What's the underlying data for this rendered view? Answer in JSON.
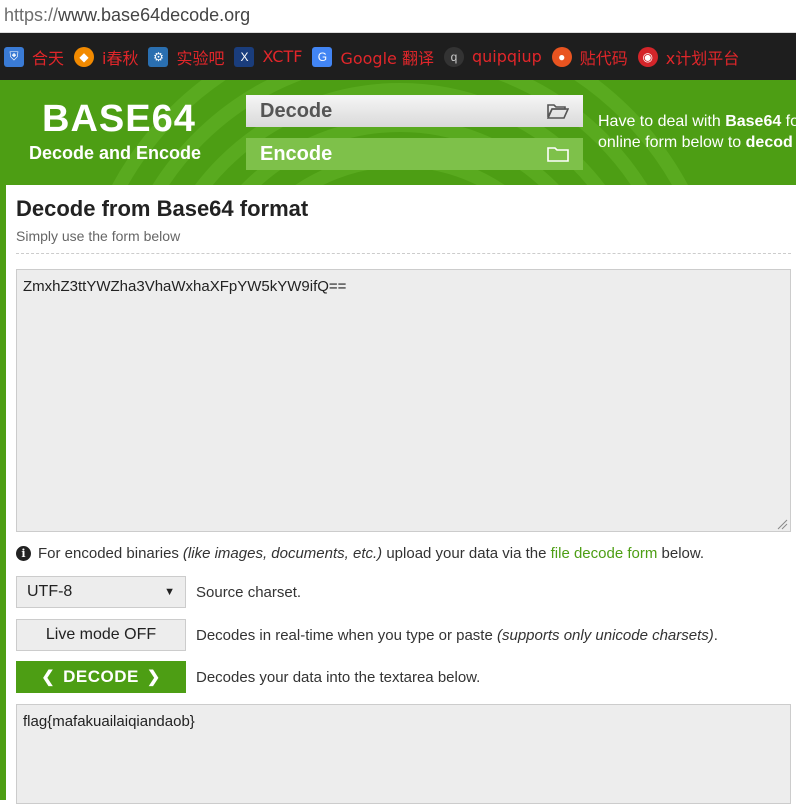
{
  "browser": {
    "url_scheme": "https://",
    "url_host": "www.base64decode.org"
  },
  "bookmarks": [
    {
      "label": "合天",
      "icon": "shield-icon",
      "color": "#3a7bd5"
    },
    {
      "label": "i春秋",
      "icon": "ichunqiu-icon",
      "color": "#f28a00"
    },
    {
      "label": "实验吧",
      "icon": "shiyanbar-icon",
      "color": "#2a6fb0"
    },
    {
      "label": "XCTF",
      "icon": "xctf-icon",
      "color": "#1a3d7c"
    },
    {
      "label": "Google 翻译",
      "icon": "google-translate-icon",
      "color": "#4285f4"
    },
    {
      "label": "quipqiup",
      "icon": "quipqiup-icon",
      "color": "#333333"
    },
    {
      "label": "贴代码",
      "icon": "ubuntu-icon",
      "color": "#e95420"
    },
    {
      "label": "x计划平台",
      "icon": "globe-icon",
      "color": "#d4252a"
    }
  ],
  "header": {
    "logo_title": "BASE64",
    "logo_subtitle": "Decode and Encode",
    "nav_decode": "Decode",
    "nav_encode": "Encode",
    "text_line1_prefix": "Have to deal with ",
    "text_line1_bold": "Base64",
    "text_line1_suffix": " fo",
    "text_line2_prefix": "online form below to ",
    "text_line2_bold": "decod"
  },
  "main": {
    "title": "Decode from Base64 format",
    "subtitle": "Simply use the form below",
    "input_value": "ZmxhZ3ttYWZha3VhaWxhaXFpYW5kYW9ifQ==",
    "info_prefix": "For encoded binaries ",
    "info_italic": "(like images, documents, etc.)",
    "info_middle": " upload your data via the ",
    "info_link": "file decode form",
    "info_suffix": " below.",
    "charset_value": "UTF-8",
    "charset_label": "Source charset.",
    "live_mode_label": "Live mode OFF",
    "live_mode_desc_prefix": "Decodes in real-time when you type or paste ",
    "live_mode_desc_italic": "(supports only unicode charsets)",
    "live_mode_desc_suffix": ".",
    "decode_button": "DECODE",
    "decode_desc": "Decodes your data into the textarea below.",
    "output_value": "flag{mafakuailaiqiandaob}"
  },
  "colors": {
    "brand_green": "#4d9e14",
    "link_green": "#4d9e14",
    "bookmark_text": "#e0262a"
  }
}
